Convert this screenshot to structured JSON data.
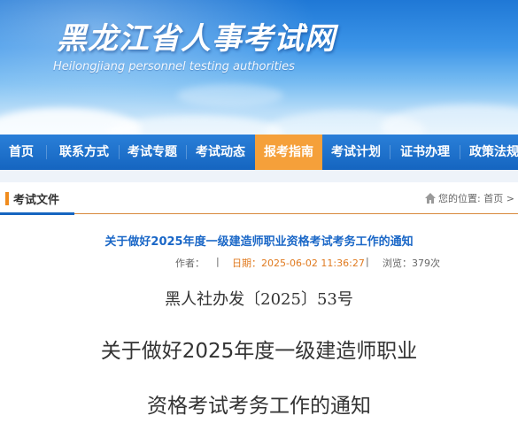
{
  "header": {
    "site_title": "黑龙江省人事考试网",
    "site_subtitle": "Heilongjiang personnel testing authorities"
  },
  "nav": {
    "items": [
      {
        "label": "首页"
      },
      {
        "label": "联系方式"
      },
      {
        "label": "考试专题"
      },
      {
        "label": "考试动态"
      },
      {
        "label": "报考指南",
        "active": true
      },
      {
        "label": "考试计划"
      },
      {
        "label": "证书办理"
      },
      {
        "label": "政策法规"
      }
    ],
    "active_color": "#f5a03a"
  },
  "section": {
    "title": "考试文件",
    "breadcrumb_prefix": "您的位置:",
    "breadcrumb_home": "首页",
    "breadcrumb_arrow": ">"
  },
  "article": {
    "title": "关于做好2025年度一级建造师职业资格考试考务工作的通知",
    "author_label": "作者：",
    "separator": "|",
    "date_label": "日期：",
    "date_value": "2025-06-02 11:36:27",
    "views_label": "浏览：",
    "views_value": "379次",
    "doc_number": "黑人社办发〔2025〕53号",
    "heading_line1": "关于做好2025年度一级建造师职业",
    "heading_line2": "资格考试考务工作的通知"
  }
}
